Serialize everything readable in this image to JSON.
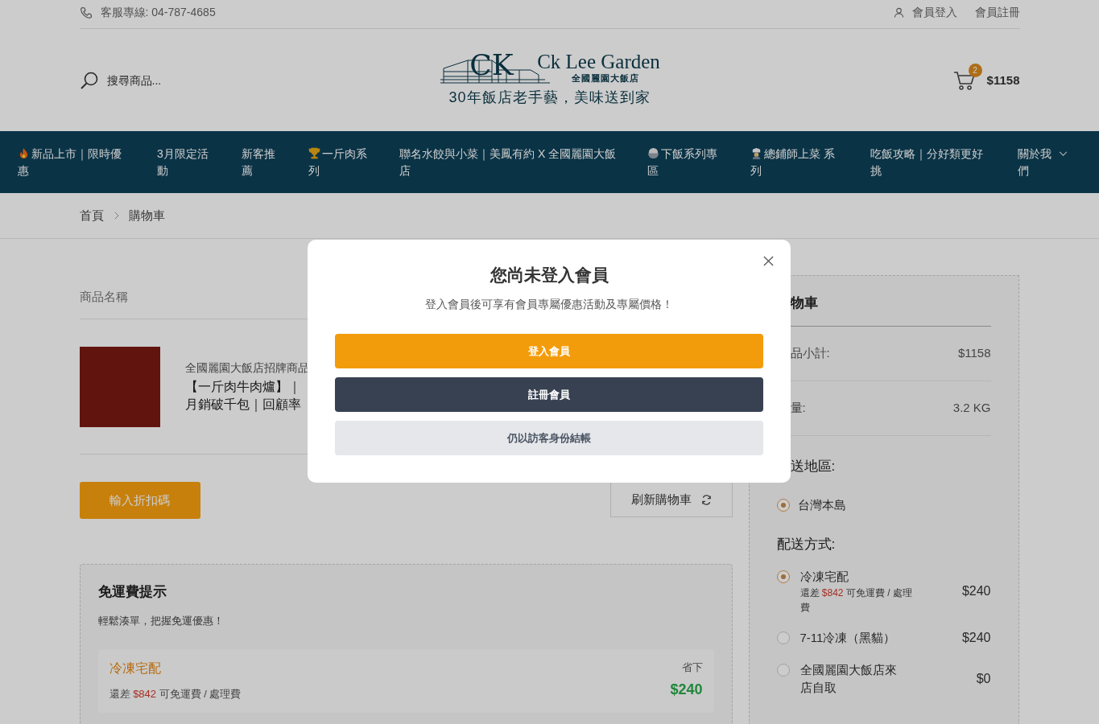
{
  "topbar": {
    "phone": "客服專線: 04-787-4685",
    "links": [
      {
        "label": "會員登入",
        "kind": "user"
      },
      {
        "label": "會員註冊",
        "kind": "plain"
      }
    ]
  },
  "header": {
    "search_placeholder": "搜尋商品...",
    "logo": {
      "monogram": "CK",
      "name": "Ck Lee Garden",
      "subname": "全國麗園大飯店",
      "tagline": "30年飯店老手藝，美味送到家"
    },
    "cart": {
      "count": "2",
      "total": "$1158"
    }
  },
  "nav": [
    {
      "label": "新品上市｜限時優惠",
      "kind": "fire"
    },
    {
      "label": "3月限定活動",
      "kind": "plain"
    },
    {
      "label": "新客推薦",
      "kind": "plain"
    },
    {
      "label": "一斤肉系列",
      "kind": "trophy"
    },
    {
      "label": "聯名水餃與小菜｜美鳳有約 X 全國麗園大飯店",
      "kind": "plain"
    },
    {
      "label": "下飯系列專區",
      "kind": "bowl"
    },
    {
      "label": "總鋪師上菜 系列",
      "kind": "chef"
    },
    {
      "label": "吃飯攻略｜分好類更好挑",
      "kind": "plain"
    },
    {
      "label": "關於我們",
      "kind": "dropdown"
    }
  ],
  "breadcrumb": [
    {
      "label": "首頁"
    },
    {
      "label": "購物車"
    }
  ],
  "cart_table": {
    "column_header": "商品名稱",
    "product": {
      "brand": "全國麗園大飯店招牌商品",
      "title": "【一斤肉牛肉爐】｜月銷破千包｜回顧率"
    }
  },
  "discount_button": "輸入折扣碼",
  "refresh_button": "刷新購物車",
  "free_shipping": {
    "title": "免運費提示",
    "subtitle": "輕鬆湊單，把握免運優惠！",
    "card": {
      "method": "冷凍宅配",
      "note_prefix": "還差",
      "note_amount": "$842",
      "note_suffix": "可免運費 / 處理費",
      "save_label": "省下",
      "save_amount": "$240"
    }
  },
  "summary": {
    "title": "物車",
    "rows": [
      {
        "label": "品小計:",
        "value": "$1158"
      },
      {
        "label": "量:",
        "value": "3.2 KG"
      }
    ],
    "region_label": "送地區:",
    "regions": [
      {
        "label": "台灣本島",
        "selected": true
      }
    ],
    "method_label": "配送方式:",
    "methods": [
      {
        "label": "冷凍宅配",
        "note_prefix": "還差",
        "note_amount": "$842",
        "note_suffix": "可免運費 / 處理費",
        "price": "$240",
        "selected": true
      },
      {
        "label": "7-11冷凍（黑貓）",
        "price": "$240",
        "selected": false
      },
      {
        "label": "全國麗園大飯店來店自取",
        "price": "$0",
        "selected": false
      }
    ]
  },
  "modal": {
    "title": "您尚未登入會員",
    "subtitle": "登入會員後可享有會員專屬優惠活動及專屬價格！",
    "buttons": [
      {
        "label": "登入會員",
        "kind": "primary"
      },
      {
        "label": "註冊會員",
        "kind": "dark"
      },
      {
        "label": "仍以訪客身份結帳",
        "kind": "light"
      }
    ]
  }
}
